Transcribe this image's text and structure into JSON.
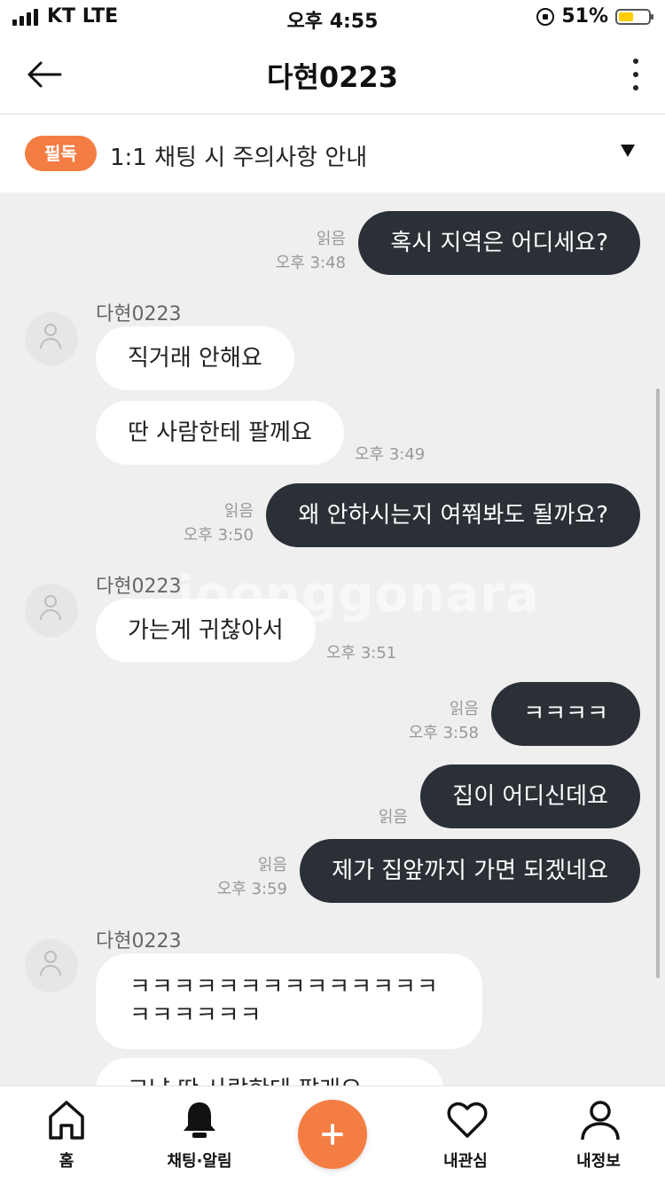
{
  "status_bar": {
    "carrier": "KT LTE",
    "time": "오후 4:55",
    "battery_percent": "51%",
    "battery_level": 0.51
  },
  "header": {
    "title": "다현0223",
    "back_icon": "arrow-left-icon",
    "more_icon": "more-vertical-icon"
  },
  "notice": {
    "badge": "필독",
    "text": "1:1 채팅 시 주의사항 안내",
    "arrow_icon": "triangle-down-icon"
  },
  "watermark": "joonggonara",
  "messages": [
    {
      "from": "me",
      "text": "혹시 지역은 어디세요?",
      "read": "읽음",
      "time": "오후 3:48"
    },
    {
      "from": "them",
      "sender": "다현0223",
      "text": "직거래 안해요"
    },
    {
      "from": "them",
      "text": "딴 사람한테 팔께요",
      "time": "오후 3:49"
    },
    {
      "from": "me",
      "text": "왜 안하시는지 여쭤봐도 될까요?",
      "read": "읽음",
      "time": "오후 3:50"
    },
    {
      "from": "them",
      "sender": "다현0223",
      "text": "가는게 귀찮아서",
      "time": "오후 3:51"
    },
    {
      "from": "me",
      "text": "ㅋㅋㅋㅋ",
      "read": "읽음",
      "time": "오후 3:58"
    },
    {
      "from": "me",
      "text": "집이 어디신데요",
      "read": "읽음"
    },
    {
      "from": "me",
      "text": "제가 집앞까지 가면 되겠네요",
      "read": "읽음",
      "time": "오후 3:59"
    },
    {
      "from": "them",
      "sender": "다현0223",
      "text": "ㅋㅋㅋㅋㅋㅋㅋㅋㅋㅋㅋㅋㅋㅋㅋㅋㅋㅋㅋㅋ"
    },
    {
      "from": "them",
      "text": "그냥 딴 사람한테 팔래요"
    }
  ],
  "tabs": [
    {
      "label": "홈",
      "icon": "home-icon"
    },
    {
      "label": "채팅·알림",
      "icon": "bell-icon"
    },
    {
      "label": "",
      "icon": "plus-icon"
    },
    {
      "label": "내관심",
      "icon": "heart-icon"
    },
    {
      "label": "내정보",
      "icon": "user-icon"
    }
  ],
  "colors": {
    "accent": "#f47d43",
    "my_bubble": "#2b2f36",
    "their_bubble": "#ffffff",
    "chat_background": "#efeff0"
  }
}
